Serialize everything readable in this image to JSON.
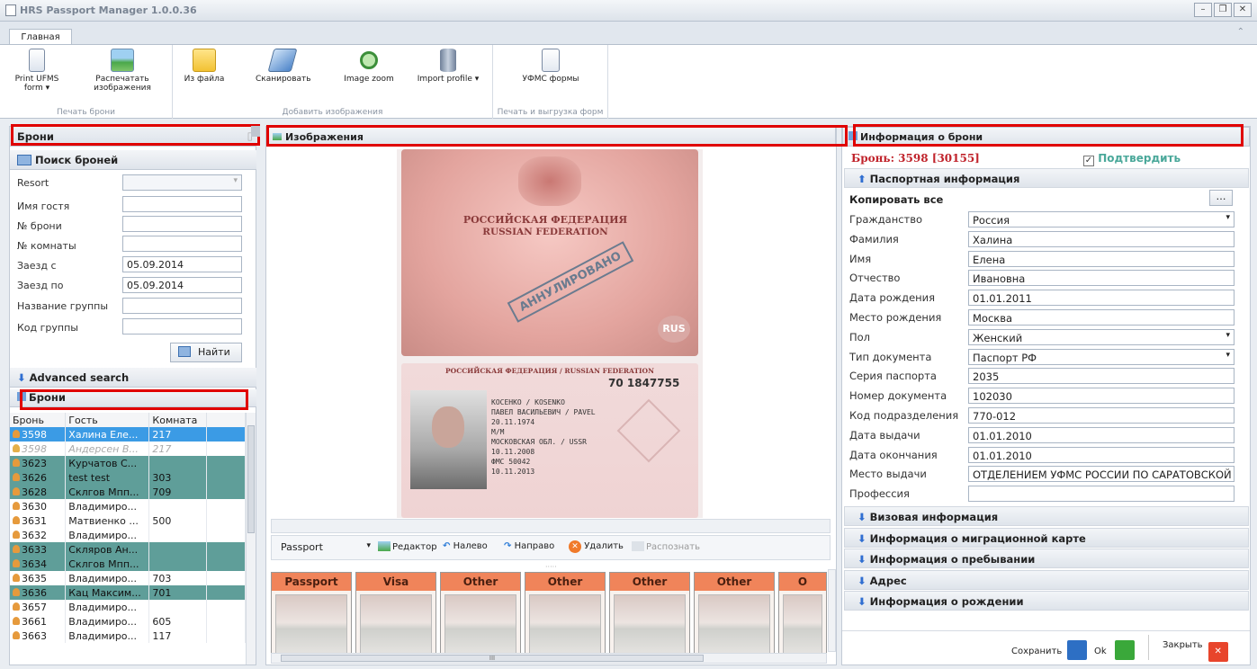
{
  "window": {
    "title": "HRS Passport Manager 1.0.0.36"
  },
  "ribbon": {
    "tab": "Главная",
    "groups": [
      {
        "label": "Печать брони",
        "buttons": [
          "Print UFMS form ▾",
          "Распечатать изображения"
        ]
      },
      {
        "label": "Добавить изображения",
        "buttons": [
          "Из файла",
          "Сканировать",
          "Image zoom",
          "Import profile ▾"
        ]
      },
      {
        "label": "Печать и выгрузка форм",
        "buttons": [
          "УФМС формы"
        ]
      }
    ]
  },
  "left": {
    "header": "Брони",
    "search_title": "Поиск броней",
    "fields": [
      {
        "label": "Resort",
        "value": ""
      },
      {
        "label": "Имя гостя",
        "value": ""
      },
      {
        "label": "№ брони",
        "value": ""
      },
      {
        "label": "№ комнаты",
        "value": ""
      },
      {
        "label": "Заезд с",
        "value": "05.09.2014"
      },
      {
        "label": "Заезд по",
        "value": "05.09.2014"
      },
      {
        "label": "Название группы",
        "value": ""
      },
      {
        "label": "Код группы",
        "value": ""
      }
    ],
    "find_button": "Найти",
    "advanced": "Advanced search",
    "list_title": "Брони",
    "columns": [
      "Бронь",
      "Гость",
      "Комната"
    ],
    "rows": [
      {
        "id": "3598",
        "guest": "Халина Еле...",
        "room": "217",
        "style": "selected"
      },
      {
        "id": "3598",
        "guest": "Андерсен В...",
        "room": "217",
        "style": "gray"
      },
      {
        "id": "3623",
        "guest": "Курчатов С...",
        "room": "",
        "style": "teal"
      },
      {
        "id": "3626",
        "guest": "test test",
        "room": "303",
        "style": "teal"
      },
      {
        "id": "3628",
        "guest": "Склгов Мпп...",
        "room": "709",
        "style": "teal"
      },
      {
        "id": "3630",
        "guest": "Владимиро...",
        "room": "",
        "style": "white"
      },
      {
        "id": "3631",
        "guest": "Матвиенко ...",
        "room": "500",
        "style": "white"
      },
      {
        "id": "3632",
        "guest": "Владимиро...",
        "room": "",
        "style": "white"
      },
      {
        "id": "3633",
        "guest": "Скляров Ан...",
        "room": "",
        "style": "teal"
      },
      {
        "id": "3634",
        "guest": "Склгов Мпп...",
        "room": "",
        "style": "teal"
      },
      {
        "id": "3635",
        "guest": "Владимиро...",
        "room": "703",
        "style": "white"
      },
      {
        "id": "3636",
        "guest": "Кац Максим...",
        "room": "701",
        "style": "teal"
      },
      {
        "id": "3657",
        "guest": "Владимиро...",
        "room": "",
        "style": "white"
      },
      {
        "id": "3661",
        "guest": "Владимиро...",
        "room": "605",
        "style": "white"
      },
      {
        "id": "3663",
        "guest": "Владимиро...",
        "room": "117",
        "style": "white"
      }
    ]
  },
  "center": {
    "header": "Изображения",
    "passport": {
      "country_ru": "РОССИЙСКАЯ ФЕДЕРАЦИЯ",
      "country_en": "RUSSIAN FEDERATION",
      "stamp": "АННУЛИРОВАНО",
      "rus": "RUS",
      "page2_title": "РОССИЙСКАЯ ФЕДЕРАЦИЯ / RUSSIAN FEDERATION",
      "number": "70 1847755",
      "surname": "КОСЕНКО / KOSENKO",
      "given": "ПАВЕЛ ВАСИЛЬЕВИЧ / PAVEL",
      "dob": "20.11.1974",
      "sex": "М/М",
      "place": "МОСКОВСКАЯ ОБЛ. / USSR",
      "issued": "10.11.2008",
      "authority": "ФМС 50042",
      "expiry": "10.11.2013"
    },
    "doc_type": "Passport",
    "tools": [
      "Редактор",
      "Налево",
      "Направо",
      "Удалить",
      "Распознать"
    ],
    "thumbs": [
      "Passport",
      "Visa",
      "Other",
      "Other",
      "Other",
      "Other",
      "O"
    ],
    "scroll_mid": "III"
  },
  "right": {
    "header": "Информация о брони",
    "booking": "Бронь: 3598 [30155]",
    "confirm": "Подтвердить",
    "passport_section": "Паспортная информация",
    "copy_all": "Копировать все",
    "fields": [
      {
        "label": "Гражданство",
        "value": "Россия",
        "dropdown": true
      },
      {
        "label": "Фамилия",
        "value": "Халина"
      },
      {
        "label": "Имя",
        "value": "Елена"
      },
      {
        "label": "Отчество",
        "value": "Ивановна"
      },
      {
        "label": "Дата рождения",
        "value": "01.01.2011"
      },
      {
        "label": "Место рождения",
        "value": "Москва"
      },
      {
        "label": "Пол",
        "value": "Женский",
        "dropdown": true
      },
      {
        "label": "Тип документа",
        "value": "Паспорт РФ",
        "dropdown": true
      },
      {
        "label": "Серия паспорта",
        "value": "2035"
      },
      {
        "label": "Номер документа",
        "value": "102030"
      },
      {
        "label": "Код подразделения",
        "value": "770-012"
      },
      {
        "label": "Дата выдачи",
        "value": "01.01.2010"
      },
      {
        "label": "Дата окончания",
        "value": "01.01.2010"
      },
      {
        "label": "Место выдачи",
        "value": "ОТДЕЛЕНИЕМ УФМС РОССИИ ПО САРАТОВСКОЙ"
      },
      {
        "label": "Профессия",
        "value": ""
      }
    ],
    "sections": [
      "Визовая информация",
      "Информация о миграционной карте",
      "Информация о пребывании",
      "Адрес",
      "Информация о рождении"
    ],
    "buttons": {
      "save": "Сохранить",
      "ok": "Ok",
      "close": "Закрыть"
    }
  }
}
